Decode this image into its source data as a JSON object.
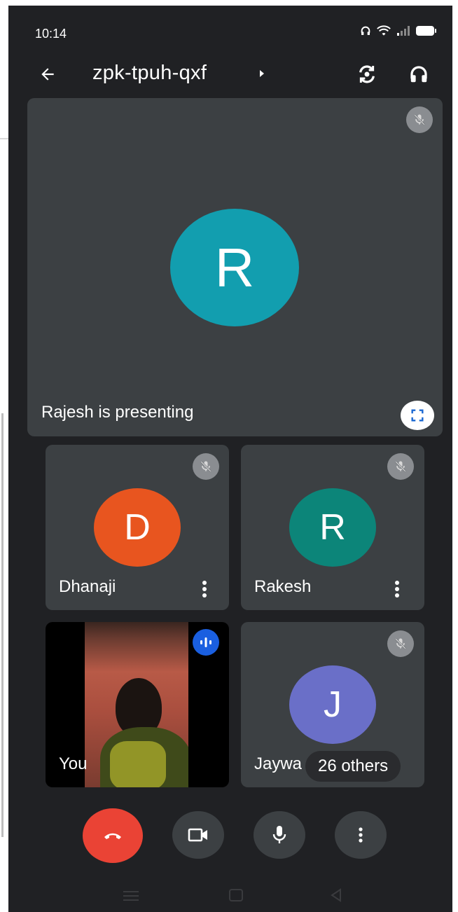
{
  "status_bar": {
    "time": "10:14"
  },
  "header": {
    "meeting_code": "zpk-tpuh-qxf"
  },
  "presenter_tile": {
    "avatar_initial": "R",
    "caption": "Rajesh is presenting",
    "avatar_color": "#129eaf"
  },
  "participants": [
    {
      "name": "Dhanaji",
      "initial": "D",
      "color": "#e8551f",
      "muted": true
    },
    {
      "name": "Rakesh",
      "initial": "R",
      "color": "#0c8579",
      "muted": true
    },
    {
      "name": "You",
      "muted": false,
      "speaking": true
    },
    {
      "name": "Jaywa",
      "initial": "J",
      "color": "#6a6fc8",
      "muted": true
    }
  ],
  "others_chip": {
    "label": "26 others"
  },
  "controls": {
    "end_call": {
      "icon": "end-call-icon",
      "color": "#ea4335"
    },
    "camera": {
      "icon": "video-camera-icon"
    },
    "microphone": {
      "icon": "microphone-icon"
    },
    "more": {
      "icon": "more-vert-icon"
    }
  },
  "theme": {
    "background": "#202124",
    "tile": "#3c4043",
    "speaking_badge": "#1a5fe0"
  }
}
